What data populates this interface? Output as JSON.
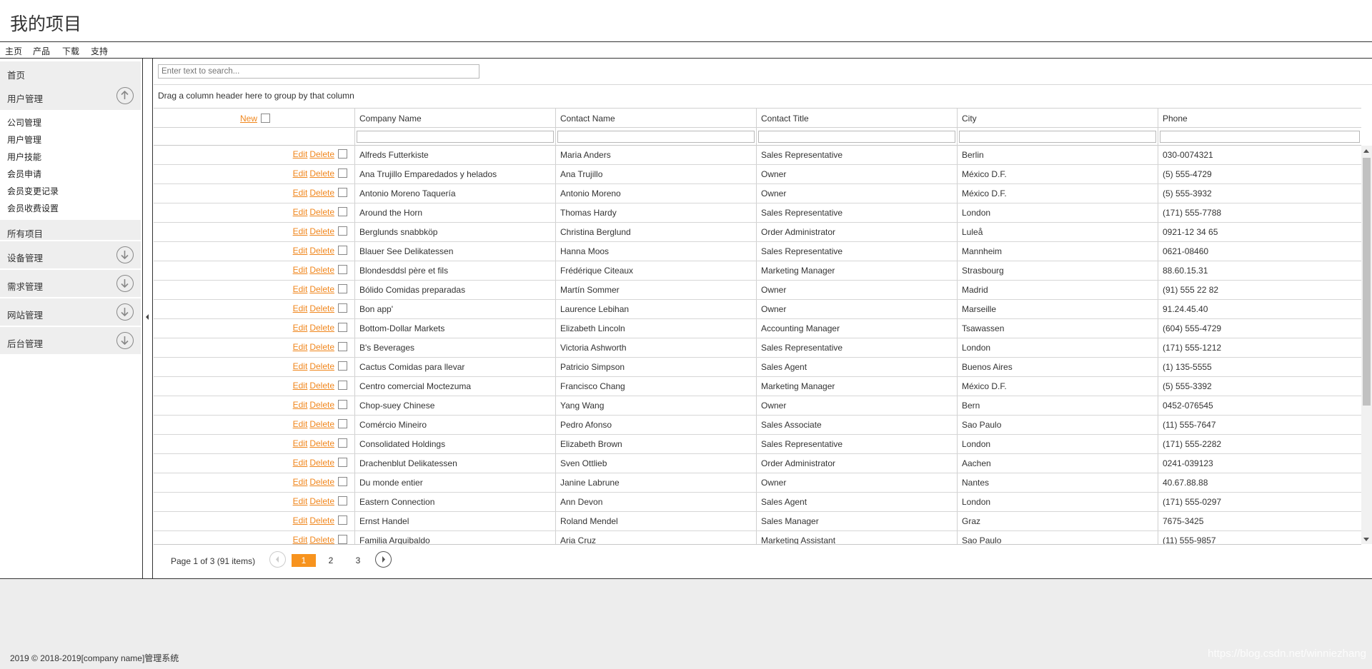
{
  "app_title": "我的项目",
  "menu": [
    "主页",
    "产品",
    "下载",
    "支持"
  ],
  "sidebar": {
    "home": "首页",
    "user_mgmt": "用户管理",
    "user_sub": [
      "公司管理",
      "用户管理",
      "用户技能",
      "会员申请",
      "会员变更记录",
      "会员收费设置"
    ],
    "all_projects": "所有项目",
    "groups": [
      "设备管理",
      "需求管理",
      "网站管理",
      "后台管理"
    ]
  },
  "search": {
    "placeholder": "Enter text to search..."
  },
  "group_panel": "Drag a column header here to group by that column",
  "grid": {
    "new_label": "New",
    "edit_label": "Edit",
    "delete_label": "Delete",
    "columns": [
      "Company Name",
      "Contact Name",
      "Contact Title",
      "City",
      "Phone"
    ],
    "rows": [
      [
        "Alfreds Futterkiste",
        "Maria Anders",
        "Sales Representative",
        "Berlin",
        "030-0074321"
      ],
      [
        "Ana Trujillo Emparedados y helados",
        "Ana Trujillo",
        "Owner",
        "México D.F.",
        "(5) 555-4729"
      ],
      [
        "Antonio Moreno Taquería",
        "Antonio Moreno",
        "Owner",
        "México D.F.",
        "(5) 555-3932"
      ],
      [
        "Around the Horn",
        "Thomas Hardy",
        "Sales Representative",
        "London",
        "(171) 555-7788"
      ],
      [
        "Berglunds snabbköp",
        "Christina Berglund",
        "Order Administrator",
        "Luleå",
        "0921-12 34 65"
      ],
      [
        "Blauer See Delikatessen",
        "Hanna Moos",
        "Sales Representative",
        "Mannheim",
        "0621-08460"
      ],
      [
        "Blondesddsl père et fils",
        "Frédérique Citeaux",
        "Marketing Manager",
        "Strasbourg",
        "88.60.15.31"
      ],
      [
        "Bólido Comidas preparadas",
        "Martín Sommer",
        "Owner",
        "Madrid",
        "(91) 555 22 82"
      ],
      [
        "Bon app'",
        "Laurence Lebihan",
        "Owner",
        "Marseille",
        "91.24.45.40"
      ],
      [
        "Bottom-Dollar Markets",
        "Elizabeth Lincoln",
        "Accounting Manager",
        "Tsawassen",
        "(604) 555-4729"
      ],
      [
        "B's Beverages",
        "Victoria Ashworth",
        "Sales Representative",
        "London",
        "(171) 555-1212"
      ],
      [
        "Cactus Comidas para llevar",
        "Patricio Simpson",
        "Sales Agent",
        "Buenos Aires",
        "(1) 135-5555"
      ],
      [
        "Centro comercial Moctezuma",
        "Francisco Chang",
        "Marketing Manager",
        "México D.F.",
        "(5) 555-3392"
      ],
      [
        "Chop-suey Chinese",
        "Yang Wang",
        "Owner",
        "Bern",
        "0452-076545"
      ],
      [
        "Comércio Mineiro",
        "Pedro Afonso",
        "Sales Associate",
        "Sao Paulo",
        "(11) 555-7647"
      ],
      [
        "Consolidated Holdings",
        "Elizabeth Brown",
        "Sales Representative",
        "London",
        "(171) 555-2282"
      ],
      [
        "Drachenblut Delikatessen",
        "Sven Ottlieb",
        "Order Administrator",
        "Aachen",
        "0241-039123"
      ],
      [
        "Du monde entier",
        "Janine Labrune",
        "Owner",
        "Nantes",
        "40.67.88.88"
      ],
      [
        "Eastern Connection",
        "Ann Devon",
        "Sales Agent",
        "London",
        "(171) 555-0297"
      ],
      [
        "Ernst Handel",
        "Roland Mendel",
        "Sales Manager",
        "Graz",
        "7675-3425"
      ],
      [
        "Familia Arquibaldo",
        "Aria Cruz",
        "Marketing Assistant",
        "Sao Paulo",
        "(11) 555-9857"
      ]
    ]
  },
  "pager": {
    "summary": "Page 1 of 3 (91 items)",
    "pages": [
      "1",
      "2",
      "3"
    ],
    "current": "1"
  },
  "footer": {
    "copyright": "2019 © 2018-2019[company name]管理系统",
    "watermark": "https://blog.csdn.net/winniezhang"
  },
  "colors": {
    "accent": "#f7931e",
    "link": "#f0861c",
    "footer_bg": "#ededed"
  }
}
